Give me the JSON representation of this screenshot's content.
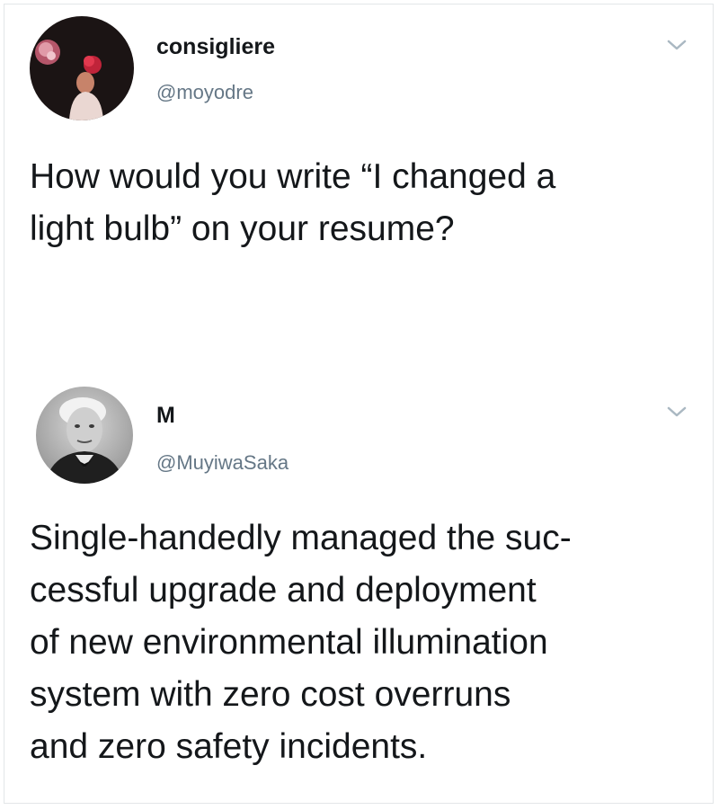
{
  "tweets": [
    {
      "display_name": "consigliere",
      "handle": "@moyodre",
      "text_lines": [
        "How would you write “I changed a",
        "light bulb” on your resume?"
      ],
      "avatar": "avatar-rose-portrait",
      "menu_icon": "chevron-down-icon"
    },
    {
      "display_name": "M",
      "handle": "@MuyiwaSaka",
      "text_lines": [
        "Single-handedly managed the suc-",
        "cessful upgrade and deployment",
        "of new environmental illumination",
        "system with zero cost overruns",
        "and zero safety incidents."
      ],
      "avatar": "avatar-vintage-portrait",
      "menu_icon": "chevron-down-icon"
    }
  ],
  "colors": {
    "text": "#14171a",
    "secondary": "#657786",
    "border": "#e3e6e8",
    "chevron": "#aab8c2"
  }
}
